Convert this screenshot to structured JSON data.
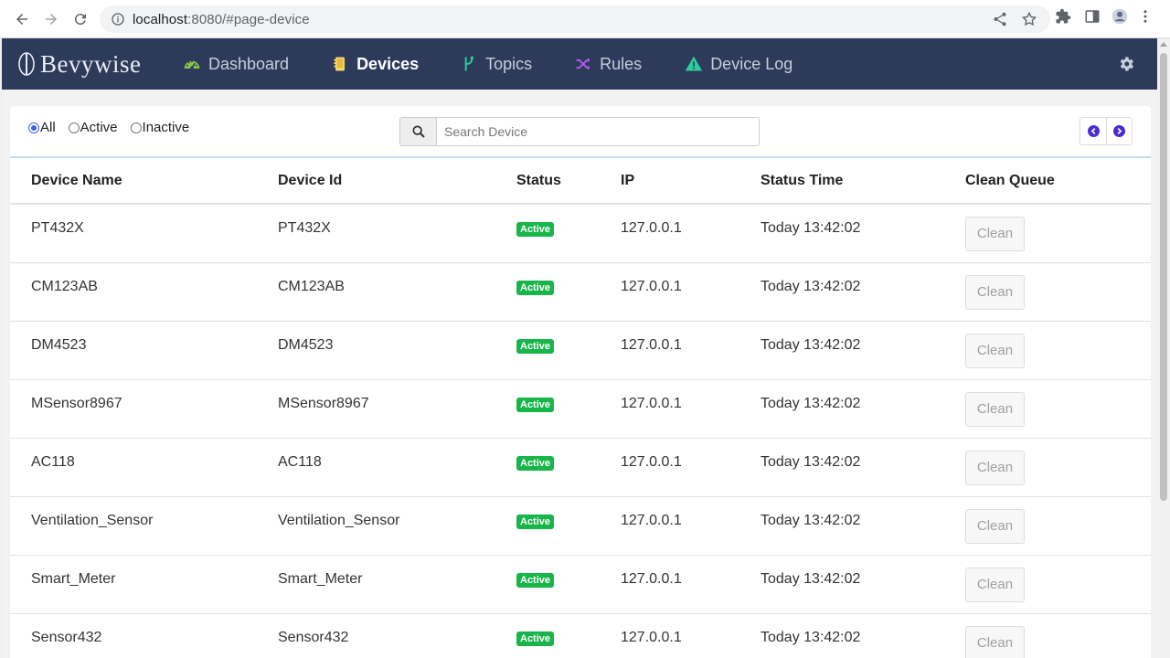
{
  "browser": {
    "url_host": "localhost",
    "url_rest": ":8080/#page-device"
  },
  "app": {
    "brand": "Bevywise",
    "nav": [
      {
        "label": "Dashboard",
        "icon": "dashboard-gauge-icon",
        "color": "#8bc34a"
      },
      {
        "label": "Devices",
        "icon": "devices-icon",
        "color": "#f7d774"
      },
      {
        "label": "Topics",
        "icon": "topics-branch-icon",
        "color": "#2ecc9a"
      },
      {
        "label": "Rules",
        "icon": "rules-shuffle-icon",
        "color": "#b25ef0"
      },
      {
        "label": "Device Log",
        "icon": "device-log-warning-icon",
        "color": "#2ecc9a"
      }
    ],
    "active_nav": "Devices"
  },
  "filters": {
    "options": [
      "All",
      "Active",
      "Inactive"
    ],
    "selected": "All"
  },
  "search": {
    "placeholder": "Search Device",
    "value": ""
  },
  "table": {
    "headers": [
      "Device Name",
      "Device Id",
      "Status",
      "IP",
      "Status Time",
      "Clean Queue"
    ],
    "rows": [
      {
        "name": "PT432X",
        "id": "PT432X",
        "status": "Active",
        "ip": "127.0.0.1",
        "time": "Today 13:42:02",
        "action": "Clean"
      },
      {
        "name": "CM123AB",
        "id": "CM123AB",
        "status": "Active",
        "ip": "127.0.0.1",
        "time": "Today 13:42:02",
        "action": "Clean"
      },
      {
        "name": "DM4523",
        "id": "DM4523",
        "status": "Active",
        "ip": "127.0.0.1",
        "time": "Today 13:42:02",
        "action": "Clean"
      },
      {
        "name": "MSensor8967",
        "id": "MSensor8967",
        "status": "Active",
        "ip": "127.0.0.1",
        "time": "Today 13:42:02",
        "action": "Clean"
      },
      {
        "name": "AC118",
        "id": "AC118",
        "status": "Active",
        "ip": "127.0.0.1",
        "time": "Today 13:42:02",
        "action": "Clean"
      },
      {
        "name": "Ventilation_Sensor",
        "id": "Ventilation_Sensor",
        "status": "Active",
        "ip": "127.0.0.1",
        "time": "Today 13:42:02",
        "action": "Clean"
      },
      {
        "name": "Smart_Meter",
        "id": "Smart_Meter",
        "status": "Active",
        "ip": "127.0.0.1",
        "time": "Today 13:42:02",
        "action": "Clean"
      },
      {
        "name": "Sensor432",
        "id": "Sensor432",
        "status": "Active",
        "ip": "127.0.0.1",
        "time": "Today 13:42:02",
        "action": "Clean"
      }
    ]
  },
  "colors": {
    "navbar": "#2d3a59",
    "active_badge": "#17b54a",
    "pager_icon": "#4b2bd1"
  }
}
